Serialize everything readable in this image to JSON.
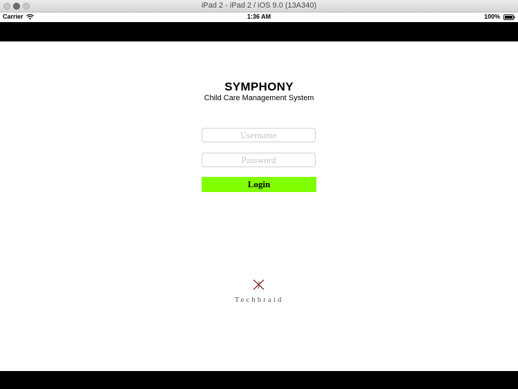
{
  "window": {
    "title": "iPad 2 - iPad 2 / iOS 9.0 (13A340)"
  },
  "status_bar": {
    "carrier": "Carrier",
    "time": "1:36 AM",
    "battery": "100%"
  },
  "app": {
    "title": "SYMPHONY",
    "subtitle": "Child Care Management System"
  },
  "login_form": {
    "username_placeholder": "Username",
    "username_value": "",
    "password_placeholder": "Password",
    "password_value": "",
    "login_label": "Login"
  },
  "footer": {
    "brand": "Techbraid"
  },
  "colors": {
    "login_button": "#80ff00",
    "bars": "#000000",
    "logo_mark": "#8b1a1a"
  },
  "icons": [
    "wifi-icon",
    "battery-icon",
    "techbraid-logo-icon"
  ]
}
